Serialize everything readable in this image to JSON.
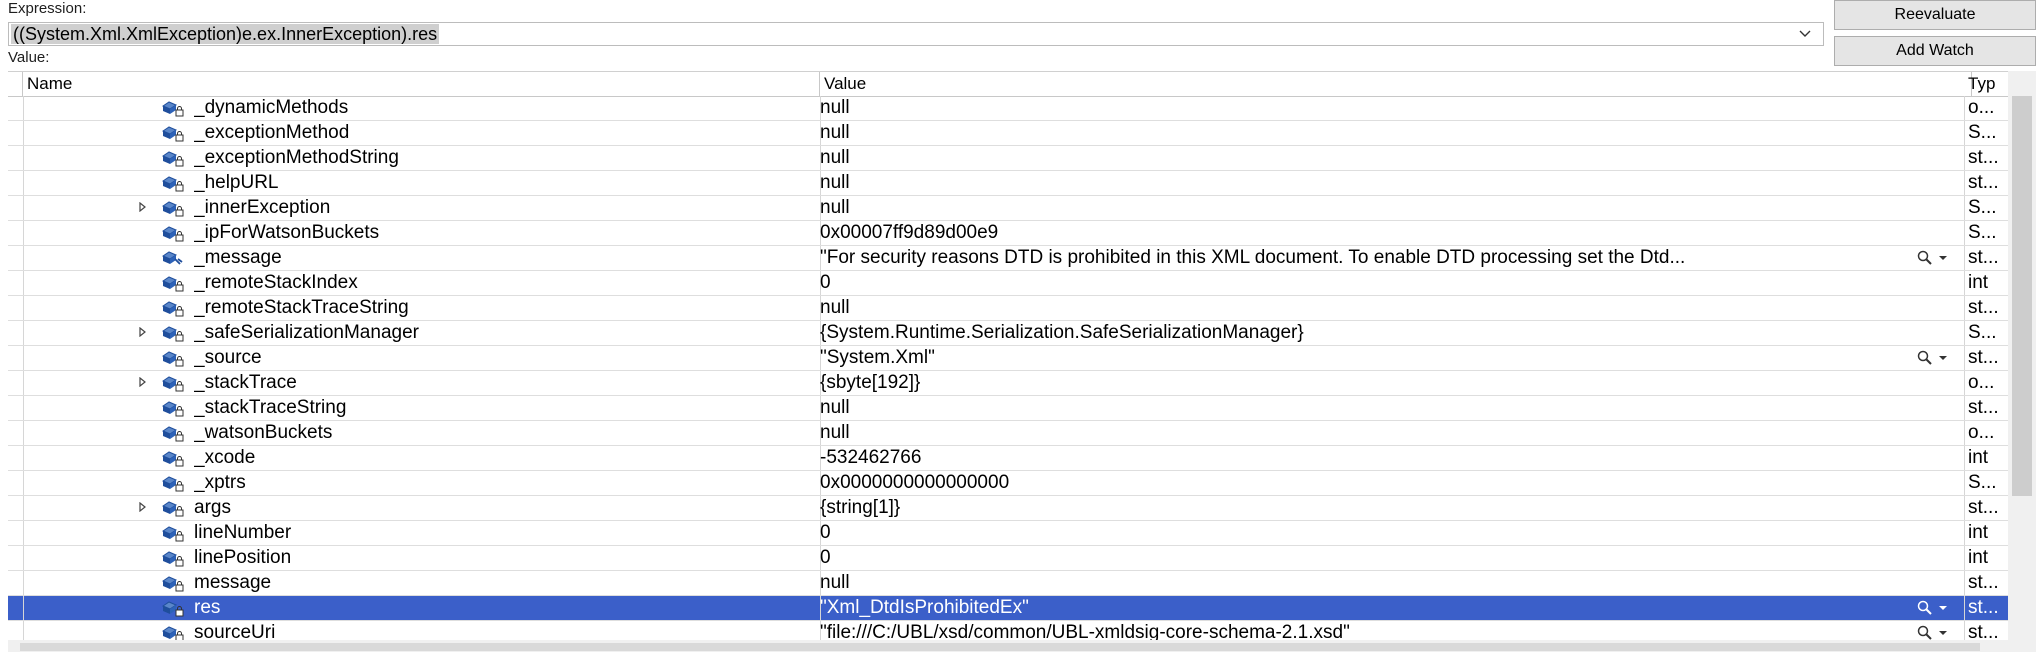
{
  "expression": {
    "label": "Expression:",
    "value": "((System.Xml.XmlException)e.ex.InnerException).res"
  },
  "value_label": "Value:",
  "buttons": {
    "reevaluate": "Reevaluate",
    "add_watch": "Add Watch"
  },
  "columns": {
    "name": "Name",
    "value": "Value",
    "type": "Typ"
  },
  "rows": [
    {
      "name": "_dynamicMethods",
      "value": "null",
      "type": "o...",
      "expandable": false,
      "icon": "private-field-icon"
    },
    {
      "name": "_exceptionMethod",
      "value": "null",
      "type": "S...",
      "expandable": false,
      "icon": "private-field-icon"
    },
    {
      "name": "_exceptionMethodString",
      "value": "null",
      "type": "st...",
      "expandable": false,
      "icon": "private-field-icon"
    },
    {
      "name": "_helpURL",
      "value": "null",
      "type": "st...",
      "expandable": false,
      "icon": "private-field-icon"
    },
    {
      "name": "_innerException",
      "value": "null",
      "type": "S...",
      "expandable": true,
      "icon": "private-field-icon"
    },
    {
      "name": "_ipForWatsonBuckets",
      "value": "0x00007ff9d89d00e9",
      "type": "S...",
      "expandable": false,
      "icon": "private-field-icon"
    },
    {
      "name": "_message",
      "value": "\"For security reasons DTD is prohibited in this XML document. To enable DTD processing set the Dtd...",
      "type": "st...",
      "expandable": false,
      "icon": "private-field-modified-icon",
      "visualizer": true
    },
    {
      "name": "_remoteStackIndex",
      "value": "0",
      "type": "int",
      "expandable": false,
      "icon": "private-field-icon"
    },
    {
      "name": "_remoteStackTraceString",
      "value": "null",
      "type": "st...",
      "expandable": false,
      "icon": "private-field-icon"
    },
    {
      "name": "_safeSerializationManager",
      "value": "{System.Runtime.Serialization.SafeSerializationManager}",
      "type": "S...",
      "expandable": true,
      "icon": "private-field-icon"
    },
    {
      "name": "_source",
      "value": "\"System.Xml\"",
      "type": "st...",
      "expandable": false,
      "icon": "private-field-icon",
      "visualizer": true
    },
    {
      "name": "_stackTrace",
      "value": "{sbyte[192]}",
      "type": "o...",
      "expandable": true,
      "icon": "private-field-icon"
    },
    {
      "name": "_stackTraceString",
      "value": "null",
      "type": "st...",
      "expandable": false,
      "icon": "private-field-icon"
    },
    {
      "name": "_watsonBuckets",
      "value": "null",
      "type": "o...",
      "expandable": false,
      "icon": "private-field-icon"
    },
    {
      "name": "_xcode",
      "value": "-532462766",
      "type": "int",
      "expandable": false,
      "icon": "private-field-icon"
    },
    {
      "name": "_xptrs",
      "value": "0x0000000000000000",
      "type": "S...",
      "expandable": false,
      "icon": "private-field-icon"
    },
    {
      "name": "args",
      "value": "{string[1]}",
      "type": "st...",
      "expandable": true,
      "icon": "private-field-icon"
    },
    {
      "name": "lineNumber",
      "value": "0",
      "type": "int",
      "expandable": false,
      "icon": "private-field-icon"
    },
    {
      "name": "linePosition",
      "value": "0",
      "type": "int",
      "expandable": false,
      "icon": "private-field-icon"
    },
    {
      "name": "message",
      "value": "null",
      "type": "st...",
      "expandable": false,
      "icon": "private-field-icon"
    },
    {
      "name": "res",
      "value": "\"Xml_DtdIsProhibitedEx\"",
      "type": "st...",
      "expandable": false,
      "icon": "private-field-icon",
      "visualizer": true,
      "selected": true
    },
    {
      "name": "sourceUri",
      "value": "\"file:///C:/UBL/xsd/common/UBL-xmldsig-core-schema-2.1.xsd\"",
      "type": "st...",
      "expandable": false,
      "icon": "private-field-icon",
      "visualizer": true
    }
  ],
  "colors": {
    "selection": "#3b5fc9",
    "icon_blue": "#1f4e9c"
  }
}
